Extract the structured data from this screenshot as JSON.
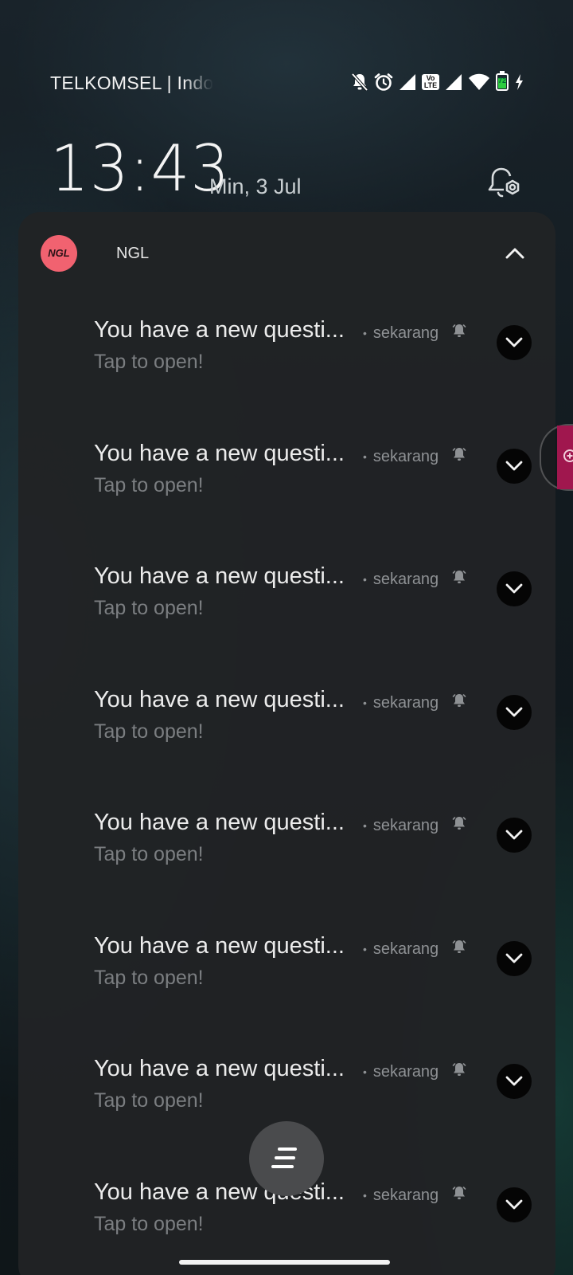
{
  "status_bar": {
    "carrier": "TELKOMSEL | Indosat",
    "volte_line1": "Vo",
    "volte_line2": "LTE",
    "battery_level": "72",
    "icons": [
      "notifications-off-icon",
      "alarm-icon",
      "signal-icon",
      "volte-icon",
      "signal-icon",
      "wifi-icon",
      "battery-icon",
      "charging-icon"
    ]
  },
  "lockscreen": {
    "time": "13:43",
    "date": "Min, 3 Jul"
  },
  "notification_group": {
    "app_logo_text": "NGL",
    "app_name": "NGL",
    "accent_color": "#f16270",
    "items": [
      {
        "title": "You have a new questi...",
        "time": "sekarang",
        "body": "Tap to open!"
      },
      {
        "title": "You have a new questi...",
        "time": "sekarang",
        "body": "Tap to open!"
      },
      {
        "title": "You have a new questi...",
        "time": "sekarang",
        "body": "Tap to open!"
      },
      {
        "title": "You have a new questi...",
        "time": "sekarang",
        "body": "Tap to open!"
      },
      {
        "title": "You have a new questi...",
        "time": "sekarang",
        "body": "Tap to open!"
      },
      {
        "title": "You have a new questi...",
        "time": "sekarang",
        "body": "Tap to open!"
      },
      {
        "title": "You have a new questi...",
        "time": "sekarang",
        "body": "Tap to open!"
      },
      {
        "title": "You have a new questi...",
        "time": "sekarang",
        "body": "Tap to open!"
      }
    ]
  },
  "side_panel": {
    "accent_color": "#a0174e"
  }
}
